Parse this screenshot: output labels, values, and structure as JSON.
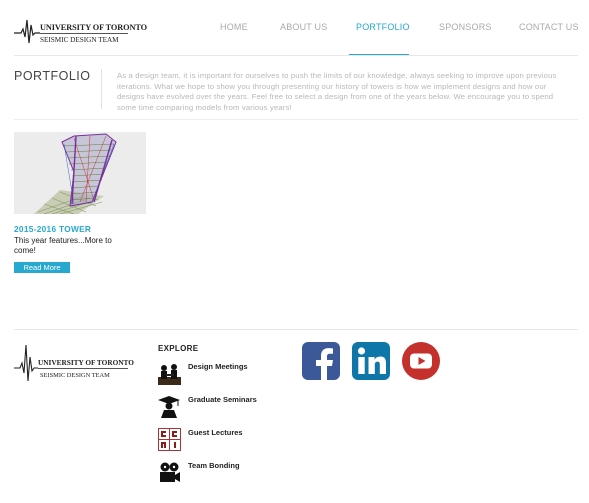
{
  "header": {
    "logo_line1": "UNIVERSITY OF TORONTO",
    "logo_line2": "SEISMIC DESIGN TEAM"
  },
  "nav": {
    "items": [
      {
        "label": "HOME"
      },
      {
        "label": "ABOUT US"
      },
      {
        "label": "PORTFOLIO"
      },
      {
        "label": "SPONSORS"
      },
      {
        "label": "CONTACT US"
      }
    ],
    "active_color": "#27a8cf",
    "inactive_color": "#aaaaaa"
  },
  "intro": {
    "title": "PORTFOLIO",
    "text": "As a design team, it is important for ourselves to push the limits of our knowledge, always seeking to improve upon previous iterations. What we hope to show you through presenting our history of towers is how we implement designs and how our designs have evolved over the years. Feel free to select a design from one of the years below. We encourage you to spend some time comparing models from various years!"
  },
  "portfolio": {
    "items": [
      {
        "title": "2015-2016 TOWER",
        "text": "This year features...More to come!",
        "button": "Read More"
      }
    ]
  },
  "footer": {
    "logo_line1": "UNIVERSITY OF TORONTO",
    "logo_line2": "SEISMIC DESIGN TEAM",
    "explore_title": "EXPLORE",
    "explore_items": [
      {
        "label": "Design Meetings",
        "icon": "meeting-icon"
      },
      {
        "label": "Graduate Seminars",
        "icon": "graduate-icon"
      },
      {
        "label": "Guest Lectures",
        "icon": "lecture-icon"
      },
      {
        "label": "Team Bonding",
        "icon": "film-icon"
      }
    ],
    "social": [
      {
        "name": "facebook",
        "icon": "facebook-icon",
        "color": "#3b5998"
      },
      {
        "name": "linkedin",
        "icon": "linkedin-icon",
        "color": "#0e76a8"
      },
      {
        "name": "youtube",
        "icon": "youtube-icon",
        "color": "#c4302b"
      }
    ]
  }
}
